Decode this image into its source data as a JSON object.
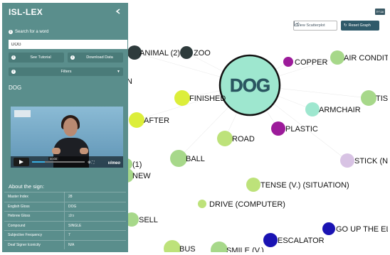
{
  "sidebar": {
    "title": "ISL-LEX",
    "search_label": "Search for a word",
    "search_value": "DOG",
    "tutorial_label": "See Tutorial",
    "download_label": "Download Data",
    "filters_label": "Filters",
    "word": "DOG",
    "video": {
      "time": "00:00",
      "brand": "vimeo"
    },
    "about_label": "About the sign:",
    "rows": [
      {
        "label": "Master Index",
        "value": "28"
      },
      {
        "label": "English Gloss",
        "value": "DOG"
      },
      {
        "label": "Hebrew Gloss",
        "value": "כלב"
      },
      {
        "label": "Compound",
        "value": "SINGLE"
      },
      {
        "label": "Subjective Frequency",
        "value": "7"
      },
      {
        "label": "Deaf Signer Iconicity",
        "value": "N/A"
      }
    ]
  },
  "toolbar": {
    "lang_label": "עברית",
    "scatter_label": "View Scatterplot",
    "reset_label": "Reset Graph"
  },
  "graph": {
    "nodes": [
      {
        "label": "ANIMAL (2)",
        "color": "#2e3b3c"
      },
      {
        "label": "ZOO",
        "color": "#2e3b3c"
      },
      {
        "label": "COPPER",
        "color": "#9c1b9a"
      },
      {
        "label": "AIR CONDIT",
        "color": "#a7d88a"
      },
      {
        "label": "DOG",
        "color": "#9ee7cf"
      },
      {
        "label": "FINISHED",
        "color": "#dcee3a"
      },
      {
        "label": "TIS",
        "color": "#a7d88a"
      },
      {
        "label": "ARMCHAIR",
        "color": "#9ee7cf"
      },
      {
        "label": "AFTER",
        "color": "#dcee3a"
      },
      {
        "label": "PLASTIC",
        "color": "#9c1b9a"
      },
      {
        "label": "ROAD",
        "color": "#bde27a"
      },
      {
        "label": "BALL",
        "color": "#a7d88a"
      },
      {
        "label": "STICK (N",
        "color": "#d8c3e4"
      },
      {
        "label": "(1)",
        "color": "#a7d88a"
      },
      {
        "label": "NEW",
        "color": "#a7d88a"
      },
      {
        "label": "TENSE (V.) (SITUATION)",
        "color": "#bde27a"
      },
      {
        "label": "DRIVE (COMPUTER)",
        "color": "#bde27a"
      },
      {
        "label": "SELL",
        "color": "#a7d88a"
      },
      {
        "label": "GO UP THE EL",
        "color": "#1a13b3"
      },
      {
        "label": "ESCALATOR",
        "color": "#1a13b3"
      },
      {
        "label": "BUS",
        "color": "#bde27a"
      },
      {
        "label": "SMILE (V.)",
        "color": "#a7d88a"
      },
      {
        "label": "N",
        "color": "#2e3b3c"
      }
    ],
    "links": [
      [
        "DOG",
        "COPPER"
      ],
      [
        "DOG",
        "AIR CONDIT"
      ],
      [
        "DOG",
        "FINISHED"
      ],
      [
        "DOG",
        "ARMCHAIR"
      ],
      [
        "DOG",
        "AFTER"
      ],
      [
        "DOG",
        "PLASTIC"
      ],
      [
        "DOG",
        "ROAD"
      ],
      [
        "DOG",
        "BALL"
      ],
      [
        "DOG",
        "TIS"
      ],
      [
        "DOG",
        "STICK (N"
      ],
      [
        "DOG",
        "ANIMAL (2)"
      ],
      [
        "DOG",
        "ZOO"
      ]
    ]
  }
}
